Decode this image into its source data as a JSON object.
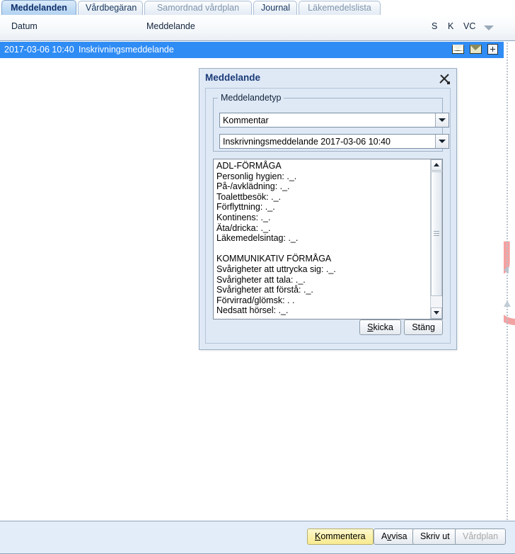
{
  "tabs": [
    {
      "label": "Meddelanden",
      "state": "active"
    },
    {
      "label": "Vårdbegäran",
      "state": "enabled"
    },
    {
      "label": "Samordnad vårdplan",
      "state": "disabled"
    },
    {
      "label": "Journal",
      "state": "enabled"
    },
    {
      "label": "Läkemedelslista",
      "state": "disabled"
    }
  ],
  "list_header": {
    "datum": "Datum",
    "meddelande": "Meddelande",
    "s": "S",
    "k": "K",
    "vc": "VC"
  },
  "message_row": {
    "date": "2017-03-06 10:40",
    "subject": "Inskrivningsmeddelande",
    "icons": [
      "open-envelope-icon",
      "closed-envelope-icon",
      "expand-plus-icon"
    ]
  },
  "dialog": {
    "title": "Meddelande",
    "tool_icon": "edit-tools-icon",
    "fieldset_legend": "Meddelandetyp",
    "type_select": {
      "value": "Kommentar",
      "options": [
        "Kommentar"
      ]
    },
    "reference_select": {
      "value": "Inskrivningsmeddelande 2017-03-06 10:40",
      "options": [
        "Inskrivningsmeddelande 2017-03-06 10:40"
      ]
    },
    "message_text": "ADL-FÖRMÅGA\nPersonlig hygien: ._.\nPå-/avklädning: ._.\nToalettbesök: ._.\nFörflyttning: ._.\nKontinens: ._.\nÄta/dricka: ._.\nLäkemedelsintag: ._.\n\nKOMMUNIKATIV FÖRMÅGA\nSvårigheter att uttrycka sig: ._.\nSvårigheter att tala: ._.\nSvårigheter att förstå: ._.\nFörvirrad/glömsk: . .\nNedsatt hörsel: ._.",
    "buttons": {
      "send": {
        "pre": "S",
        "accel": "",
        "label": "Skicka"
      },
      "close": {
        "label": "Stäng"
      }
    }
  },
  "bottom_toolbar": {
    "buttons": [
      {
        "label": "Kommentera",
        "style": "primary",
        "disabled": false
      },
      {
        "label": "Avvisa",
        "style": "normal",
        "disabled": false
      },
      {
        "label": "Skriv ut",
        "style": "normal",
        "disabled": false
      },
      {
        "label": "Vårdplan",
        "style": "normal",
        "disabled": true
      }
    ]
  },
  "watermark": {
    "text": "k U"
  },
  "colors": {
    "accent_blue": "#2f8cf5",
    "tab_active_text": "#11306b",
    "dialog_bg": "#dfe9f6",
    "toolbar_bg": "#e2edf9",
    "primary_button": "#faf0a8",
    "watermark": "#f5a0a0"
  }
}
